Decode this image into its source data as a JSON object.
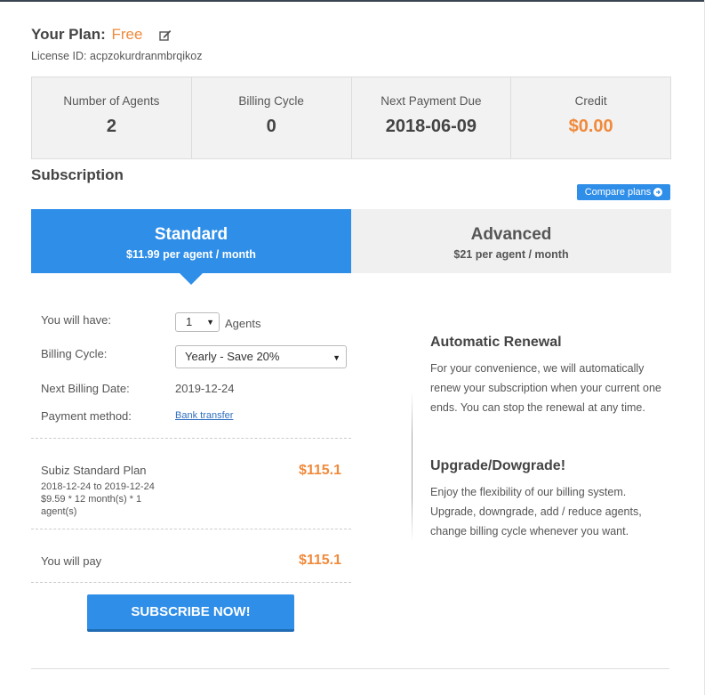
{
  "header": {
    "plan_prefix": "Your Plan:",
    "plan_name": "Free",
    "license_label": "License ID: acpzokurdranmbrqikoz",
    "edit_icon": "edit-icon"
  },
  "stats": [
    {
      "label": "Number of Agents",
      "value": "2"
    },
    {
      "label": "Billing Cycle",
      "value": "0"
    },
    {
      "label": "Next Payment Due",
      "value": "2018-06-09"
    },
    {
      "label": "Credit",
      "value": "$0.00"
    }
  ],
  "subscription": {
    "title": "Subscription",
    "compare_label": "Compare plans",
    "compare_icon": "arrow-circle-right-icon"
  },
  "plans": [
    {
      "name": "Standard",
      "price": "$11.99 per agent / month",
      "selected": true
    },
    {
      "name": "Advanced",
      "price": "$21 per agent / month",
      "selected": false
    }
  ],
  "form": {
    "have_label": "You will have:",
    "agents_value": "1",
    "agents_suffix": "Agents",
    "cycle_label": "Billing Cycle:",
    "cycle_value": "Yearly - Save 20%",
    "next_label": "Next Billing Date:",
    "next_value": "2019-12-24",
    "payment_label": "Payment method:",
    "payment_value": "Bank transfer"
  },
  "summary": {
    "plan_name": "Subiz Standard Plan",
    "plan_dates": "2018-12-24 to 2019-12-24",
    "plan_calc": "$9.59 * 12 month(s) * 1 agent(s)",
    "plan_price": "$115.1",
    "pay_label": "You will pay",
    "pay_total": "$115.1"
  },
  "subscribe_label": "SUBSCRIBE NOW!",
  "info": {
    "renewal_title": "Automatic Renewal",
    "renewal_text": "For your convenience, we will automatically renew your subscription when your current one ends. You can stop the renewal at any time.",
    "upgrade_title": "Upgrade/Dowgrade!",
    "upgrade_text": "Enjoy the flexibility of our billing system. Upgrade, downgrade, add / reduce agents, change billing cycle whenever you want."
  },
  "colors": {
    "accent": "#2f8ee8",
    "orange": "#f08a3c"
  }
}
